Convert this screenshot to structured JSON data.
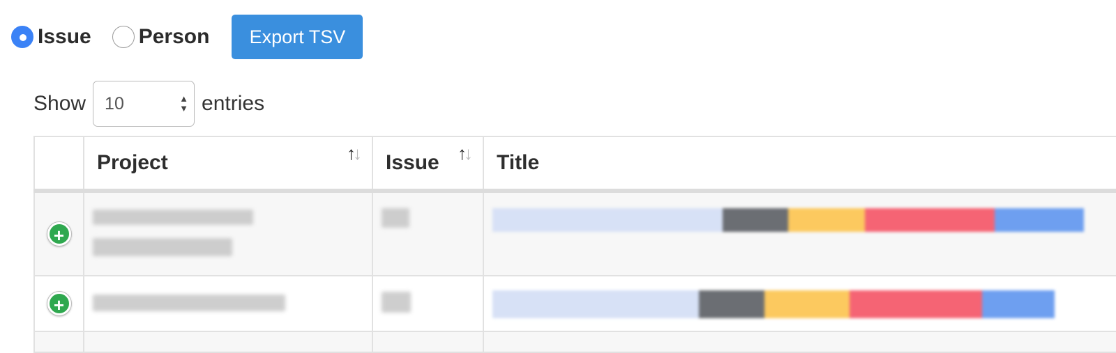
{
  "view_toggle": {
    "options": [
      {
        "label": "Issue",
        "checked": true
      },
      {
        "label": "Person",
        "checked": false
      }
    ]
  },
  "export_button": {
    "label": "Export TSV",
    "color": "#3a8fde"
  },
  "length_control": {
    "prefix": "Show",
    "value": "10",
    "suffix": "entries"
  },
  "table": {
    "columns": [
      {
        "label": ""
      },
      {
        "label": "Project"
      },
      {
        "label": "Issue"
      },
      {
        "label": "Title"
      }
    ],
    "rows": [
      {
        "project": "",
        "issue": "",
        "title": ""
      },
      {
        "project": "",
        "issue": "",
        "title": ""
      }
    ]
  },
  "icons": {
    "sort": "sort-arrows-icon",
    "expand": "plus-circle-icon"
  }
}
